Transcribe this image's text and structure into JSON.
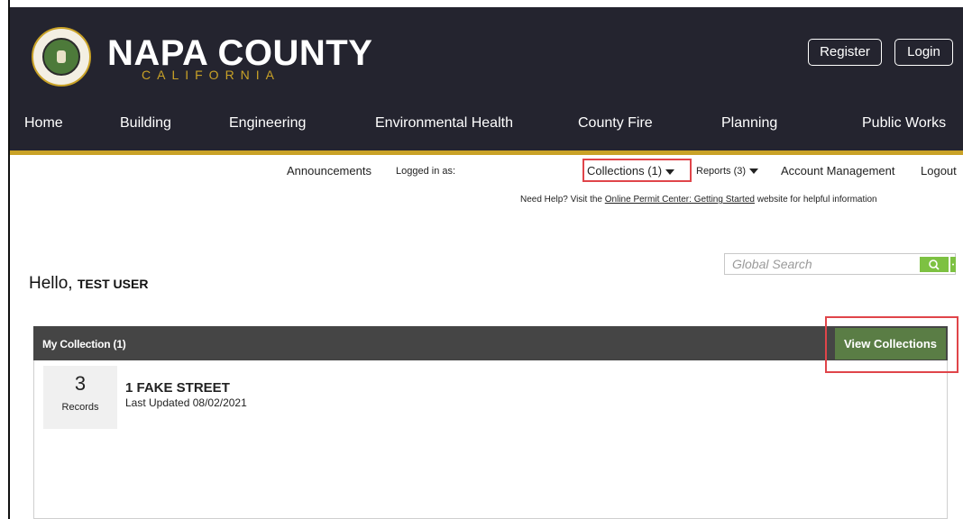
{
  "brand": {
    "title": "NAPA COUNTY",
    "subtitle": "CALIFORNIA",
    "seal_text_top": "NAPA COUNTY",
    "seal_text_bottom": "CALIFORNIA",
    "accent_color": "#c9a227",
    "header_color": "#24242f"
  },
  "auth": {
    "register_label": "Register",
    "login_label": "Login"
  },
  "nav": {
    "items": [
      "Home",
      "Building",
      "Engineering",
      "Environmental Health",
      "County Fire",
      "Planning",
      "Public Works"
    ]
  },
  "topnav": {
    "announcements": "Announcements",
    "logged_in": "Logged in as:",
    "collections": "Collections (1)",
    "reports": "Reports (3)",
    "account": "Account Management",
    "logout": "Logout"
  },
  "help": {
    "prefix": "Need Help? Visit the",
    "link": "Online Permit Center: Getting Started",
    "suffix": "website for helpful information"
  },
  "search": {
    "placeholder": "Global Search",
    "icon": "search-icon"
  },
  "greeting": {
    "hello": "Hello,",
    "user": "TEST USER"
  },
  "collection_panel": {
    "title": "My Collection (1)",
    "view_button": "View Collections",
    "items": [
      {
        "count": "3",
        "count_label": "Records",
        "name": "1 FAKE STREET",
        "updated": "Last Updated 08/02/2021"
      }
    ]
  },
  "highlight_color": "#e0454a"
}
